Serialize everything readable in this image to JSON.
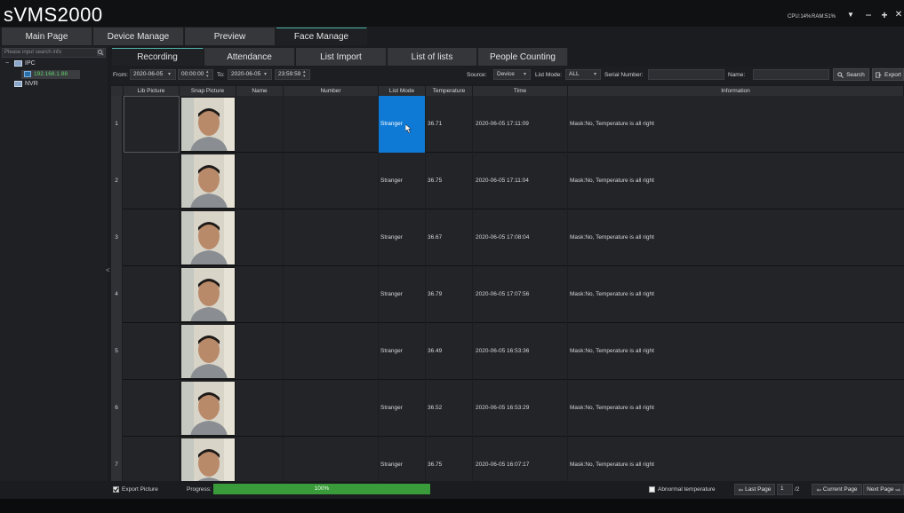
{
  "app": {
    "title": "sVMS2000"
  },
  "system": {
    "cpu": "CPU:14%",
    "ram": "RAM:51%"
  },
  "window_controls": {
    "menu": "▼",
    "minimize": "−",
    "maximize": "+",
    "close": "✕"
  },
  "main_tabs": [
    {
      "label": "Main Page"
    },
    {
      "label": "Device Manage"
    },
    {
      "label": "Preview"
    },
    {
      "label": "Face Manage",
      "active": true
    }
  ],
  "sidebar": {
    "search_placeholder": "Please input search info",
    "tree": [
      {
        "label": "IPC",
        "children": [
          {
            "label": "192.168.1.88"
          }
        ]
      },
      {
        "label": "NVR"
      }
    ]
  },
  "sub_tabs": [
    {
      "label": "Recording",
      "active": true
    },
    {
      "label": "Attendance"
    },
    {
      "label": "List Import"
    },
    {
      "label": "List of lists"
    },
    {
      "label": "People Counting"
    }
  ],
  "filters": {
    "from_label": "From:",
    "from_date": "2020-06-05",
    "from_time": "00:00:00",
    "to_label": "To:",
    "to_date": "2020-06-05",
    "to_time": "23:59:59",
    "source_label": "Source:",
    "source_value": "Device",
    "list_mode_label": "List Mode:",
    "list_mode_value": "ALL",
    "serial_label": "Serial Number:",
    "serial_value": "",
    "name_label": "Name:",
    "name_value": "",
    "search_button": "Search",
    "export_button": "Export"
  },
  "table": {
    "columns": [
      "Lib Picture",
      "Snap Picture",
      "Name",
      "Number",
      "List Mode",
      "Temperature",
      "Time",
      "Information"
    ],
    "rows": [
      {
        "index": "1",
        "name": "",
        "number": "",
        "list_mode": "Stranger",
        "temperature": "36.71",
        "time": "2020-06-05 17:11:09",
        "information": "Mask:No, Temperature is all right"
      },
      {
        "index": "2",
        "name": "",
        "number": "",
        "list_mode": "Stranger",
        "temperature": "36.75",
        "time": "2020-06-05 17:11:04",
        "information": "Mask:No, Temperature is all right"
      },
      {
        "index": "3",
        "name": "",
        "number": "",
        "list_mode": "Stranger",
        "temperature": "36.67",
        "time": "2020-06-05 17:08:04",
        "information": "Mask:No, Temperature is all right"
      },
      {
        "index": "4",
        "name": "",
        "number": "",
        "list_mode": "Stranger",
        "temperature": "36.79",
        "time": "2020-06-05 17:07:56",
        "information": "Mask:No, Temperature is all right"
      },
      {
        "index": "5",
        "name": "",
        "number": "",
        "list_mode": "Stranger",
        "temperature": "36.49",
        "time": "2020-06-05 16:53:36",
        "information": "Mask:No, Temperature is all right"
      },
      {
        "index": "6",
        "name": "",
        "number": "",
        "list_mode": "Stranger",
        "temperature": "36.52",
        "time": "2020-06-05 16:53:29",
        "information": "Mask:No, Temperature is all right"
      },
      {
        "index": "7",
        "name": "",
        "number": "",
        "list_mode": "Stranger",
        "temperature": "36.75",
        "time": "2020-06-05 16:07:17",
        "information": "Mask:No, Temperature is all right"
      }
    ]
  },
  "bottom": {
    "export_picture_label": "Export Picture",
    "export_picture_checked": true,
    "progress_label": "Progress:",
    "progress_value": 1.0,
    "progress_text": "100%",
    "abnormal_label": "Abnormal temperature",
    "abnormal_checked": false,
    "last_page": "Last Page",
    "page_current": "1",
    "page_total": "/2",
    "current_page": "Current Page",
    "next_page": "Next Page"
  },
  "colors": {
    "accent": "#4fb3a8",
    "selection": "#0f7ad6",
    "progress": "#3a9b3a",
    "ip_text": "#62d26a"
  }
}
